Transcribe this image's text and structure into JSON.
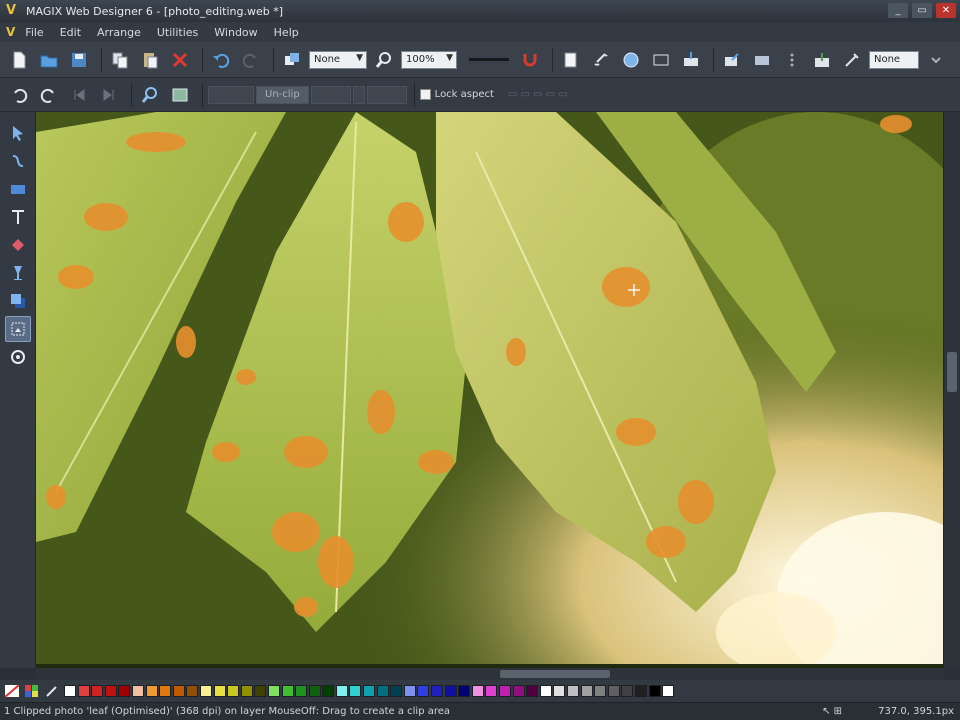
{
  "window": {
    "title": "MAGIX Web Designer 6 - [photo_editing.web *]",
    "controls": [
      "_",
      "▭",
      "✕"
    ]
  },
  "menu": {
    "items": [
      "File",
      "Edit",
      "Arrange",
      "Utilities",
      "Window",
      "Help"
    ]
  },
  "toolbar1": {
    "feather_select": "None",
    "zoom_select": "100%",
    "transparency_select": "None"
  },
  "toolbar2": {
    "buttons": [
      "",
      "Un-clip",
      ""
    ],
    "lock_aspect_label": "Lock aspect"
  },
  "tools": [
    "selector-tool",
    "contour-tool",
    "rectangle-tool",
    "text-tool",
    "fill-tool",
    "transparency-tool",
    "shadow-tool",
    "photo-tool",
    "feather-tool"
  ],
  "palette": {
    "colors": [
      "#ffffff",
      "#e04040",
      "#d12222",
      "#c01010",
      "#a00000",
      "#f0c0a0",
      "#f09a30",
      "#e07a10",
      "#c05a00",
      "#905000",
      "#f8f090",
      "#e8e040",
      "#c8c820",
      "#909000",
      "#404000",
      "#80e060",
      "#40c030",
      "#209020",
      "#106010",
      "#004000",
      "#80f0f0",
      "#30d0d0",
      "#10a0b0",
      "#007080",
      "#004050",
      "#8090f0",
      "#3040e0",
      "#2020c0",
      "#1010a0",
      "#000070",
      "#f090e0",
      "#e040d0",
      "#c020b0",
      "#901080",
      "#500040",
      "#ffffff",
      "#e0e0e0",
      "#c0c0c0",
      "#a0a0a0",
      "#808080",
      "#606060",
      "#404040",
      "#202020",
      "#000000",
      "#ffffff"
    ]
  },
  "status": {
    "message": "1 Clipped photo 'leaf (Optimised)' (368 dpi) on layer MouseOff: Drag to create a clip area",
    "coords": "737.0, 395.1px"
  }
}
